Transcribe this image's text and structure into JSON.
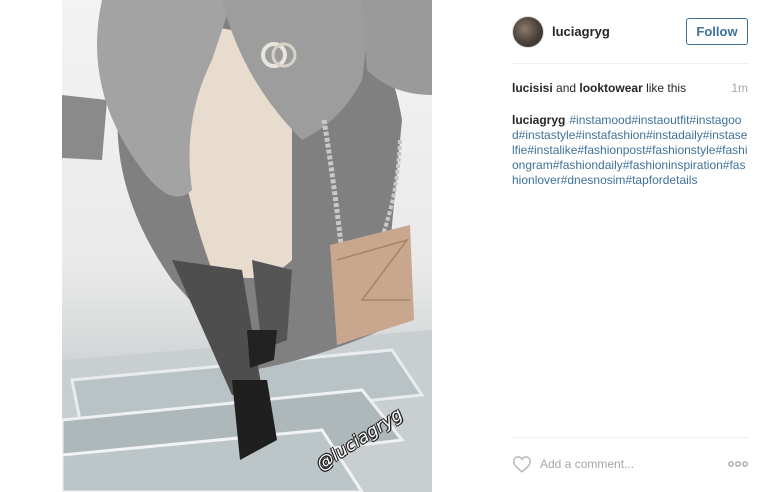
{
  "post": {
    "username": "luciagryg",
    "follow_label": "Follow",
    "likes": {
      "user1": "lucisisi",
      "connector": " and ",
      "user2": "looktowear",
      "suffix": " like this"
    },
    "time_ago": "1m",
    "caption": {
      "author": "luciagryg",
      "tags": "#instamood#instaoutfit#instagood#instastyle#instafashion#instadaily#instaselfie#instalike#fashionpost#fashionstyle#fashiongram#fashiondaily#fashioninspiration#fashionlover#dnesnosim#tapfordetails"
    },
    "photo_watermark": "@luciagryg",
    "comment_placeholder": "Add a comment...",
    "colors": {
      "accent": "#3f729b",
      "text": "#262626",
      "muted": "#a5a7aa"
    },
    "icons": [
      "heart-icon",
      "more-options-icon"
    ]
  }
}
